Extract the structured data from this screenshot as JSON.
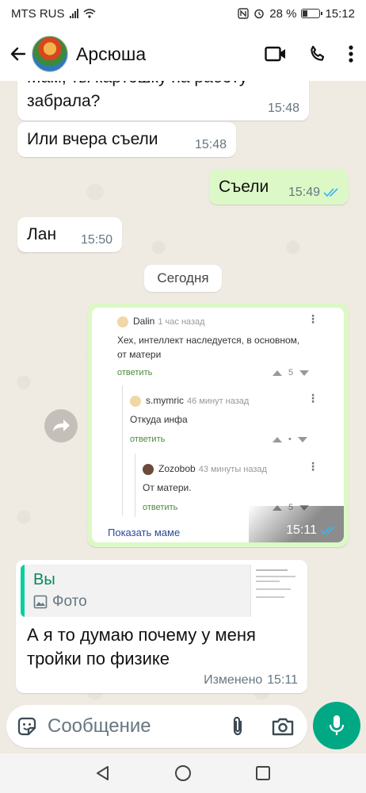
{
  "status_bar": {
    "carrier": "MTS RUS",
    "battery": "28 %",
    "time": "15:12"
  },
  "header": {
    "contact_name": "Арсюша"
  },
  "messages": [
    {
      "direction": "in",
      "text_line1": "Мам, ты картошку на работу",
      "text_line2": "забрала?",
      "time": "15:48"
    },
    {
      "direction": "in",
      "text": "Или вчера съели",
      "time": "15:48"
    },
    {
      "direction": "out",
      "text": "Съели",
      "time": "15:49",
      "status": "read"
    },
    {
      "direction": "in",
      "text": "Лан",
      "time": "15:50"
    }
  ],
  "day_chip": "Сегодня",
  "image_message": {
    "direction": "out",
    "time": "15:11",
    "status": "read",
    "screenshot": {
      "comments": [
        {
          "author": "Dalin",
          "meta": "1 час назад",
          "text_line1": "Хех, интеллект наследуется, в основном,",
          "text_line2": "от матери",
          "reply": "ответить",
          "votes": "5"
        },
        {
          "author": "s.mymric",
          "meta": "46 минут назад",
          "text": "Откуда инфа",
          "reply": "ответить",
          "votes": "•"
        },
        {
          "author": "Zozobob",
          "meta": "43 минуты назад",
          "text": "От матери.",
          "reply": "ответить",
          "votes": "5"
        }
      ],
      "footer_link": "Показать маме"
    }
  },
  "reply_message": {
    "quote_author": "Вы",
    "quote_type": "Фото",
    "text_line1": "А я то думаю почему у меня",
    "text_line2": "тройки по физике",
    "edited_label": "Изменено",
    "time": "15:11"
  },
  "input": {
    "placeholder": "Сообщение"
  },
  "colors": {
    "accent": "#00a884",
    "outgoing_bubble": "#dcf8c6",
    "incoming_bubble": "#ffffff",
    "read_ticks": "#34b7f1",
    "chat_bg": "#efeae2"
  }
}
